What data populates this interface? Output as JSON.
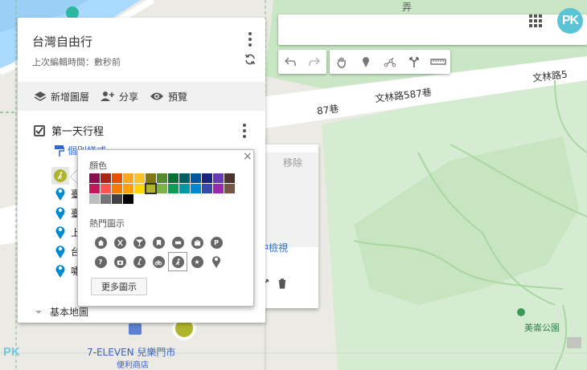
{
  "app": {
    "avatar_text": "PK",
    "corner_watermark": "PK"
  },
  "map_labels": {
    "road_1": "文林路587巷",
    "road_2": "文林路5",
    "road_3": "87巷",
    "road_top": "弄",
    "park": "美崙公園",
    "store_name": "7-ELEVEN 兒樂門市",
    "store_sub": "便利商店"
  },
  "panel": {
    "title": "台灣自由行",
    "edit_time": "上次編輯時間：數秒前",
    "actions": {
      "add_layer": "新增圖層",
      "share": "分享",
      "preview": "預覽"
    },
    "layer": {
      "name": "第一天行程",
      "checked": true,
      "style_link": "個別樣式",
      "places": [
        "臺",
        "臺",
        "上",
        "台",
        "嘯"
      ]
    },
    "base_map": "基本地圖"
  },
  "card": {
    "remove": "移除",
    "zoom": "中檢視"
  },
  "popup": {
    "close": "×",
    "color_label": "顏色",
    "icons_label": "熱門圖示",
    "more_icons": "更多圖示",
    "colors": [
      "#880e4f",
      "#a52714",
      "#e65100",
      "#f9a825",
      "#fbc02d",
      "#817717",
      "#558b2f",
      "#097138",
      "#006064",
      "#01579b",
      "#1a237e",
      "#673ab7",
      "#4e342e",
      "#c2185b",
      "#ff5252",
      "#f57c00",
      "#ffa000",
      "#ffd600",
      "#afb42b",
      "#7cb342",
      "#0f9d58",
      "#0097a7",
      "#0288d1",
      "#3949ab",
      "#9c27b0",
      "#795548",
      "#bdbdbd",
      "#757575",
      "#424242",
      "#000000"
    ],
    "selected_color_index": 18,
    "icons": [
      "home-icon",
      "restaurant-icon",
      "bar-icon",
      "cafe-icon",
      "hotel-icon",
      "shopping-icon",
      "parking-icon",
      "help-icon",
      "camera-icon",
      "walking-icon",
      "cycling-icon",
      "hiking-icon",
      "star-icon",
      "pin-icon"
    ],
    "selected_icon_index": 11
  }
}
